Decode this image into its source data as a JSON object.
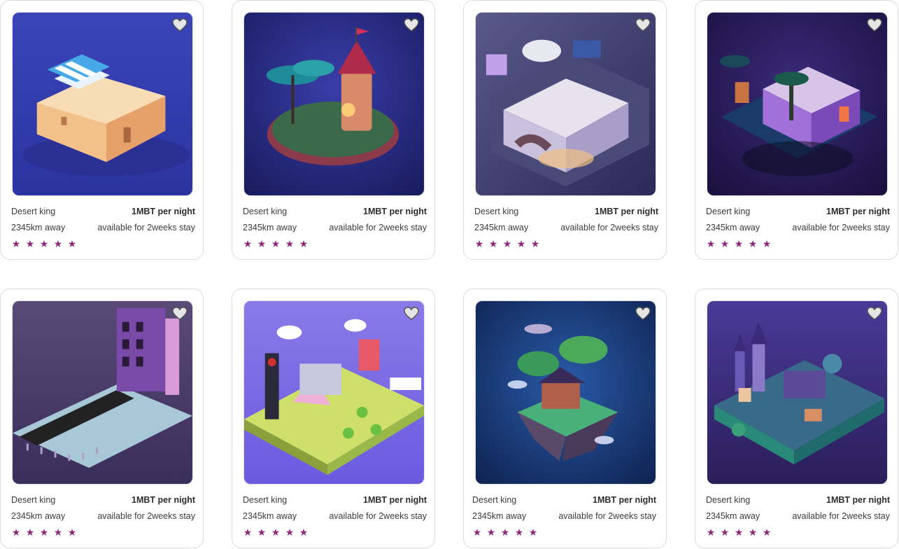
{
  "colors": {
    "star": "#8c2a78",
    "heart_fill": "#e6e6e6",
    "heart_stroke": "#555555"
  },
  "listings": [
    {
      "name": "Desert king",
      "price": "1MBT per night",
      "distance": "2345km away",
      "availability": "available for 2weeks stay",
      "rating": 5,
      "image_theme": "desert-house",
      "favorite_icon": "heart-icon"
    },
    {
      "name": "Desert king",
      "price": "1MBT per night",
      "distance": "2345km away",
      "availability": "available for 2weeks stay",
      "rating": 5,
      "image_theme": "forest-castle-island",
      "favorite_icon": "heart-icon"
    },
    {
      "name": "Desert king",
      "price": "1MBT per night",
      "distance": "2345km away",
      "availability": "available for 2weeks stay",
      "rating": 5,
      "image_theme": "futuristic-house",
      "favorite_icon": "heart-icon"
    },
    {
      "name": "Desert king",
      "price": "1MBT per night",
      "distance": "2345km away",
      "availability": "available for 2weeks stay",
      "rating": 5,
      "image_theme": "neon-jungle-temple",
      "favorite_icon": "heart-icon"
    },
    {
      "name": "Desert king",
      "price": "1MBT per night",
      "distance": "2345km away",
      "availability": "available for 2weeks stay",
      "rating": 5,
      "image_theme": "purple-tower-street",
      "favorite_icon": "heart-icon"
    },
    {
      "name": "Desert king",
      "price": "1MBT per night",
      "distance": "2345km away",
      "availability": "available for 2weeks stay",
      "rating": 5,
      "image_theme": "colorful-city-island",
      "favorite_icon": "heart-icon"
    },
    {
      "name": "Desert king",
      "price": "1MBT per night",
      "distance": "2345km away",
      "availability": "available for 2weeks stay",
      "rating": 5,
      "image_theme": "floating-tree-house",
      "favorite_icon": "heart-icon"
    },
    {
      "name": "Desert king",
      "price": "1MBT per night",
      "distance": "2345km away",
      "availability": "available for 2weeks stay",
      "rating": 5,
      "image_theme": "night-castle-town",
      "favorite_icon": "heart-icon"
    }
  ]
}
